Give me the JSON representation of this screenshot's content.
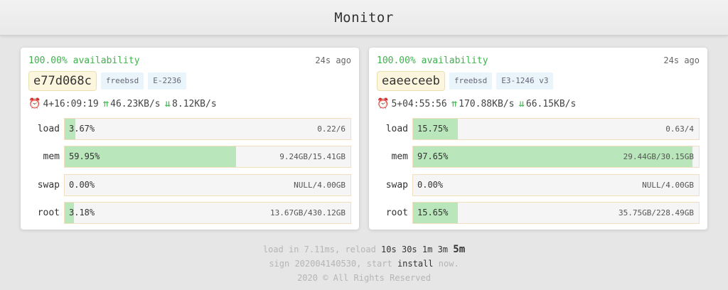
{
  "header": {
    "title": "Monitor"
  },
  "servers": [
    {
      "availability": "100.00% availability",
      "ago": "24s ago",
      "host": "e77d068c",
      "os": "freebsd",
      "cpu": "E-2236",
      "uptime": "4+16:09:19",
      "up": "46.23KB/s",
      "down": "8.12KB/s",
      "metrics": [
        {
          "label": "load",
          "pct": "3.67%",
          "value": "0.22/6",
          "fill": 0.0367
        },
        {
          "label": "mem",
          "pct": "59.95%",
          "value": "9.24GB/15.41GB",
          "fill": 0.5995
        },
        {
          "label": "swap",
          "pct": "0.00%",
          "value": "NULL/4.00GB",
          "fill": 0.0
        },
        {
          "label": "root",
          "pct": "3.18%",
          "value": "13.67GB/430.12GB",
          "fill": 0.0318
        }
      ]
    },
    {
      "availability": "100.00% availability",
      "ago": "24s ago",
      "host": "eaeeceeb",
      "os": "freebsd",
      "cpu": "E3-1246 v3",
      "uptime": "5+04:55:56",
      "up": "170.88KB/s",
      "down": "66.15KB/s",
      "metrics": [
        {
          "label": "load",
          "pct": "15.75%",
          "value": "0.63/4",
          "fill": 0.1575
        },
        {
          "label": "mem",
          "pct": "97.65%",
          "value": "29.44GB/30.15GB",
          "fill": 0.9765
        },
        {
          "label": "swap",
          "pct": "0.00%",
          "value": "NULL/4.00GB",
          "fill": 0.0
        },
        {
          "label": "root",
          "pct": "15.65%",
          "value": "35.75GB/228.49GB",
          "fill": 0.1565
        }
      ]
    }
  ],
  "footer": {
    "load_prefix": "load in 7.11ms, reload",
    "reload_options": [
      "10s",
      "30s",
      "1m",
      "3m",
      "5m"
    ],
    "sign_prefix": "sign 202004140530, start",
    "install_label": "install",
    "sign_suffix": "now.",
    "copyright": "2020 © All Rights Reserved"
  },
  "colors": {
    "green": "#3cb44b",
    "bar_fill": "#b9e6ba"
  },
  "icons": {
    "uptime": "alarm-clock-icon",
    "upload": "arrow-up-icon",
    "download": "arrow-down-icon"
  }
}
